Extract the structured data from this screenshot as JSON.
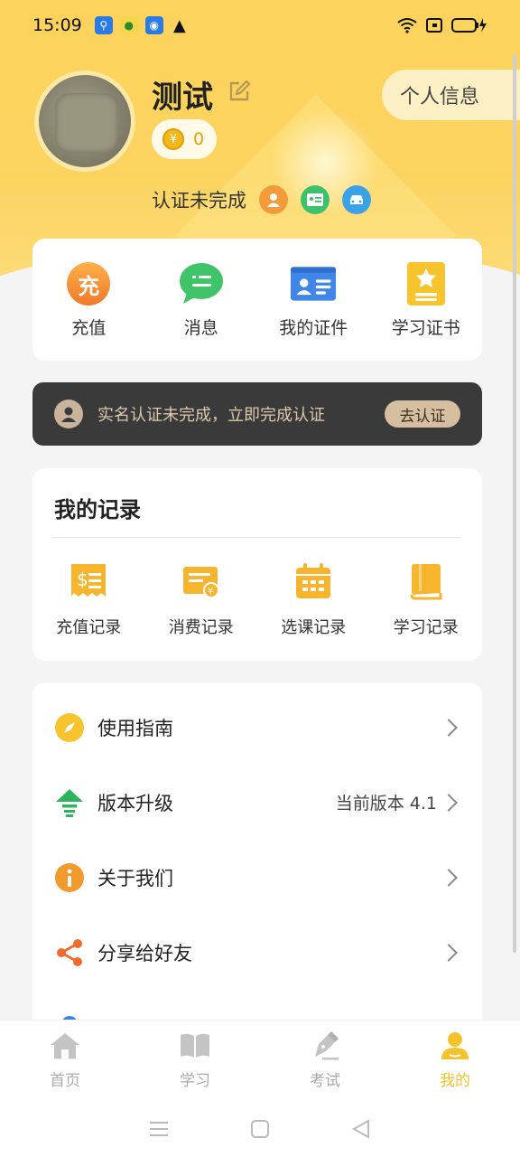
{
  "status_bar": {
    "time": "15:09"
  },
  "profile": {
    "username": "测试",
    "coins": "0",
    "coin_symbol": "¥",
    "profile_button": "个人信息",
    "certification_status": "认证未完成"
  },
  "quick_actions": [
    {
      "label": "充值",
      "icon": "recharge-icon",
      "glyph": "充"
    },
    {
      "label": "消息",
      "icon": "message-icon"
    },
    {
      "label": "我的证件",
      "icon": "id-card-icon"
    },
    {
      "label": "学习证书",
      "icon": "certificate-icon"
    }
  ],
  "banner": {
    "text": "实名认证未完成，立即完成认证",
    "button": "去认证"
  },
  "records": {
    "title": "我的记录",
    "items": [
      {
        "label": "充值记录",
        "icon": "recharge-record-icon"
      },
      {
        "label": "消费记录",
        "icon": "consume-record-icon"
      },
      {
        "label": "选课记录",
        "icon": "course-record-icon"
      },
      {
        "label": "学习记录",
        "icon": "study-record-icon"
      }
    ]
  },
  "menu": [
    {
      "label": "使用指南",
      "icon": "compass-icon",
      "extra": ""
    },
    {
      "label": "版本升级",
      "icon": "upgrade-icon",
      "extra": "当前版本 4.1"
    },
    {
      "label": "关于我们",
      "icon": "info-icon",
      "extra": ""
    },
    {
      "label": "分享给好友",
      "icon": "share-icon",
      "extra": ""
    }
  ],
  "tabs": [
    {
      "label": "首页",
      "icon": "home-icon",
      "active": false
    },
    {
      "label": "学习",
      "icon": "book-icon",
      "active": false
    },
    {
      "label": "考试",
      "icon": "exam-pen-icon",
      "active": false
    },
    {
      "label": "我的",
      "icon": "user-icon",
      "active": true
    }
  ],
  "colors": {
    "accent": "#f6c22b",
    "header": "#fcd35c",
    "banner": "#3a3a3a"
  }
}
